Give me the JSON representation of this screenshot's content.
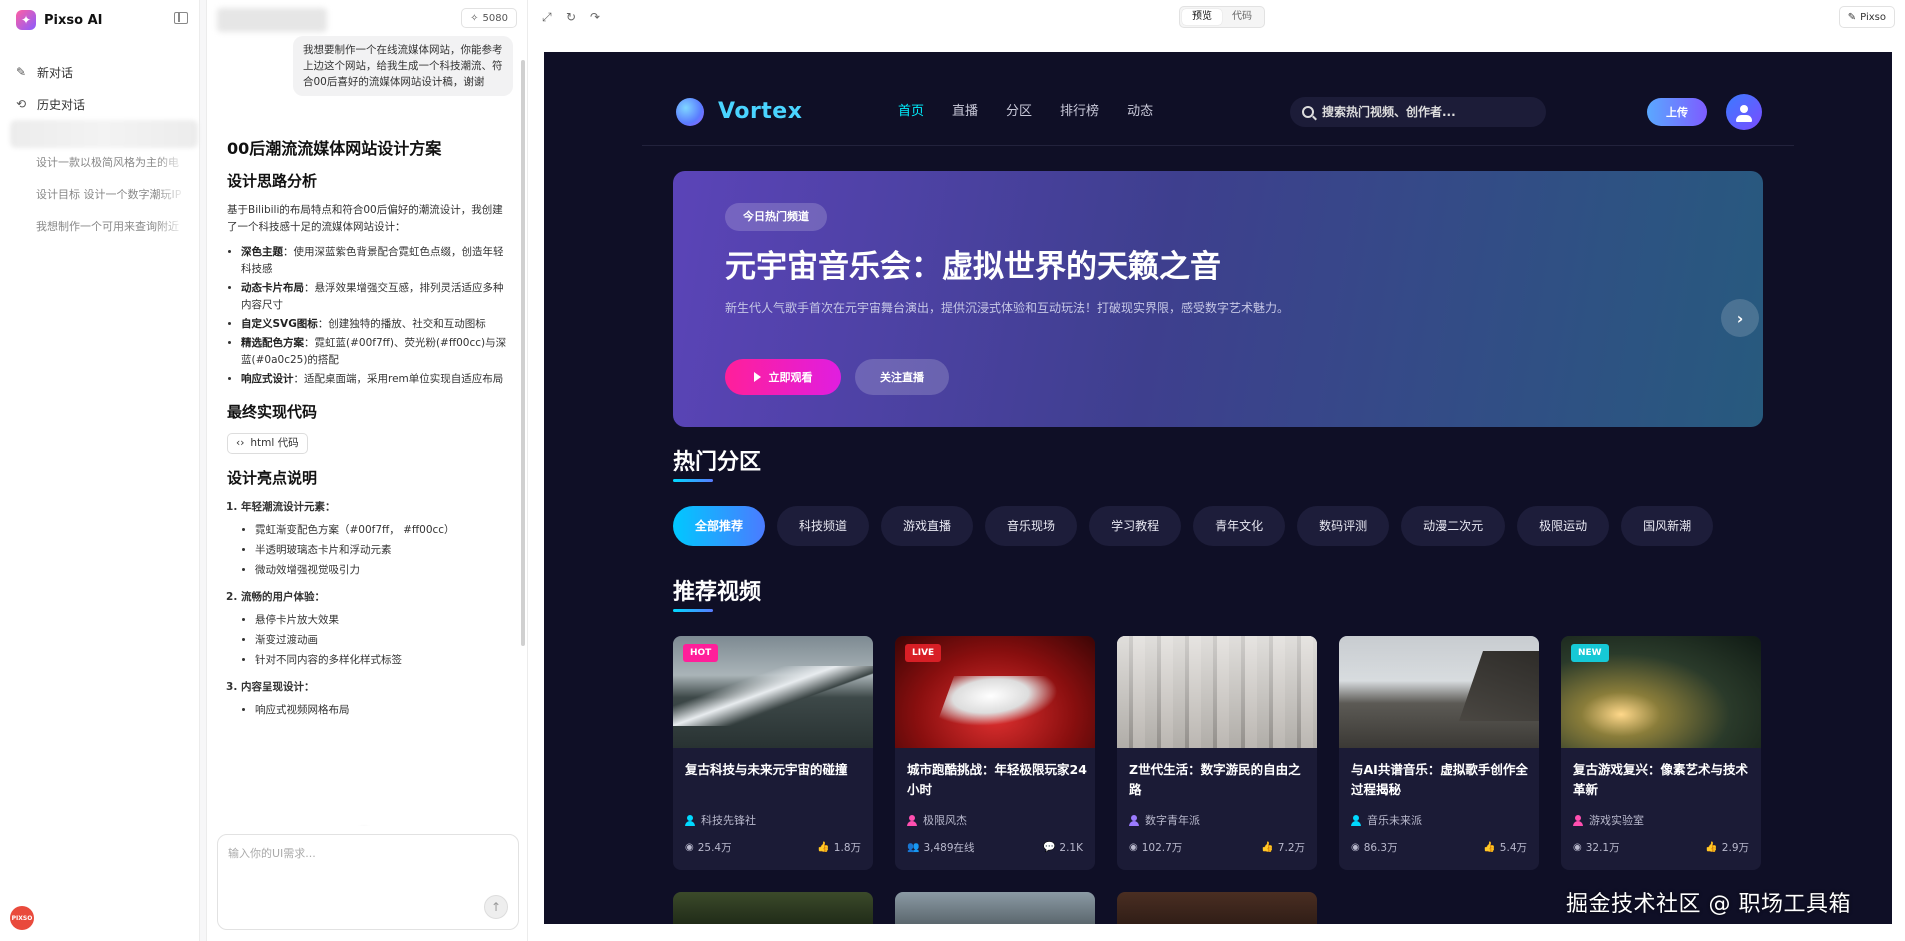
{
  "app": {
    "brand": "Pixso AI",
    "user_avatar_text": "PIXSO"
  },
  "sidebar": {
    "nav": [
      {
        "label": "新对话",
        "icon": "edit-icon"
      },
      {
        "label": "历史对话",
        "icon": "history-icon"
      }
    ],
    "history": [
      "设计一款以极简风格为主的电",
      "设计目标 设计一个数字潮玩IP",
      "我想制作一个可用来查询附近"
    ]
  },
  "chat": {
    "credits": "5080",
    "user_message": "我想要制作一个在线流媒体网站，你能参考上边这个网站，给我生成一个科技潮流、符合00后喜好的流媒体网站设计稿，谢谢",
    "doc_title": "00后潮流流媒体网站设计方案",
    "section1_title": "设计思路分析",
    "section1_intro": "基于Bilibili的布局特点和符合00后偏好的潮流设计，我创建了一个科技感十足的流媒体网站设计：",
    "section1_points": [
      {
        "bold": "深色主题",
        "text": "：使用深蓝紫色背景配合霓虹色点缀，创造年轻科技感"
      },
      {
        "bold": "动态卡片布局",
        "text": "：悬浮效果增强交互感，排列灵活适应多种内容尺寸"
      },
      {
        "bold": "自定义SVG图标",
        "text": "：创建独特的播放、社交和互动图标"
      },
      {
        "bold": "精选配色方案",
        "text": "：霓虹蓝(#00f7ff)、荧光粉(#ff00cc)与深蓝(#0a0c25)的搭配"
      },
      {
        "bold": "响应式设计",
        "text": "：适配桌面端，采用rem单位实现自适应布局"
      }
    ],
    "section2_title": "最终实现代码",
    "code_chip": "html 代码",
    "section3_title": "设计亮点说明",
    "highlights": [
      {
        "title": "年轻潮流设计元素：",
        "items": [
          "霓虹渐变配色方案（#00f7ff， #ff00cc）",
          "半透明玻璃态卡片和浮动元素",
          "微动效增强视觉吸引力"
        ]
      },
      {
        "title": "流畅的用户体验：",
        "items": [
          "悬停卡片放大效果",
          "渐变过渡动画",
          "针对不同内容的多样化样式标签"
        ]
      },
      {
        "title": "内容呈现设计：",
        "items": [
          "响应式视频网格布局"
        ]
      }
    ],
    "input_placeholder": "输入你的UI需求..."
  },
  "preview_toolbar": {
    "tabs": [
      "预览",
      "代码"
    ],
    "active_tab": "预览",
    "pixso_button": "Pixso"
  },
  "site": {
    "logo_text": "Vortex",
    "nav": [
      "首页",
      "直播",
      "分区",
      "排行榜",
      "动态"
    ],
    "active_nav": "首页",
    "search_placeholder": "搜索热门视频、创作者...",
    "upload_label": "上传",
    "hero": {
      "badge": "今日热门频道",
      "title": "元宇宙音乐会：虚拟世界的天籁之音",
      "desc": "新生代人气歌手首次在元宇宙舞台演出，提供沉浸式体验和互动玩法！打破现实界限，感受数字艺术魅力。",
      "play_label": "立即观看",
      "follow_label": "关注直播"
    },
    "section_categories": "热门分区",
    "categories": [
      "全部推荐",
      "科技频道",
      "游戏直播",
      "音乐现场",
      "学习教程",
      "青年文化",
      "数码评测",
      "动漫二次元",
      "极限运动",
      "国风新潮"
    ],
    "section_videos": "推荐视频",
    "videos": [
      {
        "badge": "HOT",
        "title": "复古科技与未来元宇宙的碰撞",
        "author": "科技先锋社",
        "left_stat": "25.4万",
        "right_stat": "1.8万",
        "left_icon": "eye-icon",
        "right_icon": "thumbs-up-icon"
      },
      {
        "badge": "LIVE",
        "title": "城市跑酷挑战：年轻极限玩家24小时",
        "author": "极限风杰",
        "left_stat": "3,489在线",
        "right_stat": "2.1K",
        "left_icon": "viewers-icon",
        "right_icon": "comment-icon"
      },
      {
        "badge": "",
        "title": "Z世代生活：数字游民的自由之路",
        "author": "数字青年派",
        "left_stat": "102.7万",
        "right_stat": "7.2万",
        "left_icon": "eye-icon",
        "right_icon": "thumbs-up-icon"
      },
      {
        "badge": "",
        "title": "与AI共谱音乐：虚拟歌手创作全过程揭秘",
        "author": "音乐未来派",
        "left_stat": "86.3万",
        "right_stat": "5.4万",
        "left_icon": "eye-icon",
        "right_icon": "thumbs-up-icon"
      },
      {
        "badge": "NEW",
        "title": "复古游戏复兴：像素艺术与技术革新",
        "author": "游戏实验室",
        "left_stat": "32.1万",
        "right_stat": "2.9万",
        "left_icon": "eye-icon",
        "right_icon": "thumbs-up-icon"
      }
    ]
  },
  "watermark": "掘金技术社区 @ 职场工具箱",
  "colors": {
    "site_bg": "#0f0f26",
    "neon_blue": "#00f0ff",
    "neon_pink": "#ff1f9a",
    "card_bg": "#1b1b36"
  }
}
